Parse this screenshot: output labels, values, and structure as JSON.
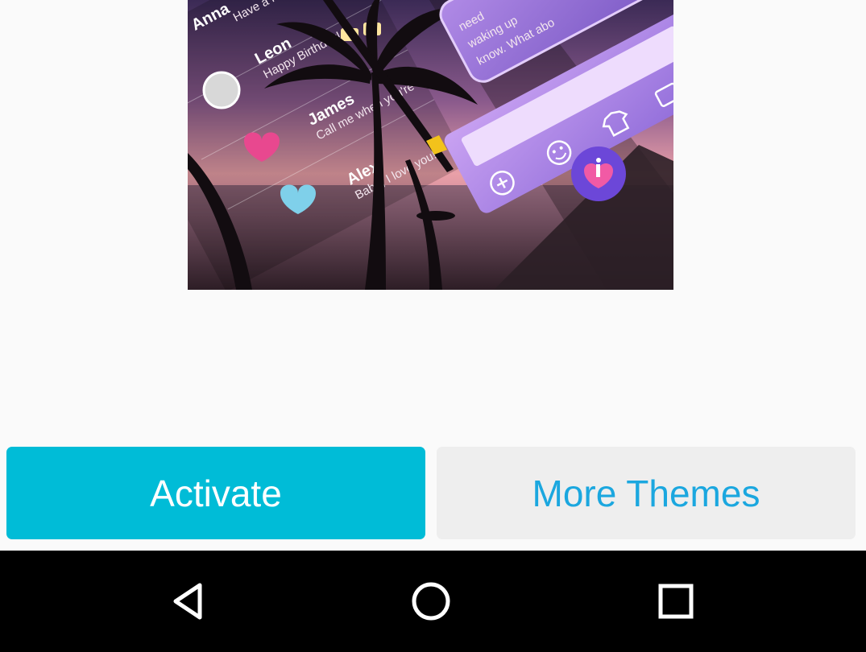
{
  "theme_preview": {
    "contacts": [
      {
        "name": "Anna",
        "message": "Have a nice"
      },
      {
        "name": "Leon",
        "message": "Happy Birthday!"
      },
      {
        "name": "James",
        "message": "Call me when you're free"
      },
      {
        "name": "Alex",
        "message": "Babe, I love you!"
      }
    ],
    "bubble_text": [
      "need",
      "waking up",
      "know. What abo"
    ]
  },
  "actions": {
    "activate_label": "Activate",
    "more_themes_label": "More Themes"
  },
  "navigation": {
    "back_icon": "back-triangle-icon",
    "home_icon": "home-circle-icon",
    "recents_icon": "recents-square-icon"
  },
  "colors": {
    "activate_bg": "#00bcd7",
    "more_themes_bg": "#eeeeee",
    "more_themes_text": "#1ba7df",
    "navbar_bg": "#000000"
  }
}
